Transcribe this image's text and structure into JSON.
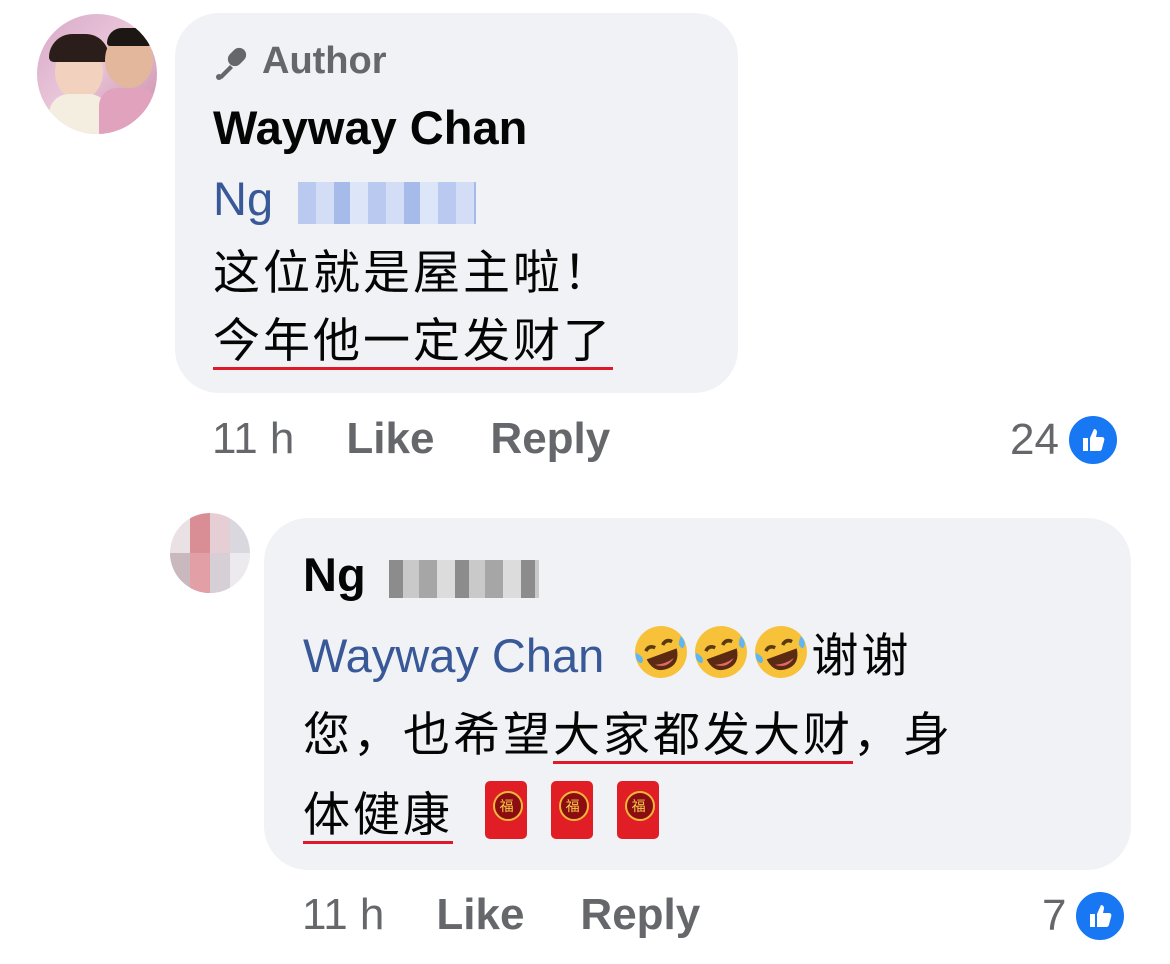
{
  "comment1": {
    "badge": "Author",
    "author": "Wayway Chan",
    "mention": "Ng",
    "line1": "这位就是屋主啦！",
    "line2": "今年他一定发财了",
    "time": "11 h",
    "like_label": "Like",
    "reply_label": "Reply",
    "like_count": "24"
  },
  "comment2": {
    "author": "Ng",
    "mention": "Wayway Chan",
    "emoji_name": "rolling-on-floor-laughing",
    "text_after_emoji": "谢谢",
    "line2_plain": "您，也希望",
    "line2_underlined": "大家都发大财",
    "line2_end": "，身",
    "line3_underlined": "体健康",
    "envelope_glyph": "福",
    "time": "11 h",
    "like_label": "Like",
    "reply_label": "Reply",
    "like_count": "7"
  },
  "colors": {
    "bubble": "#f0f2f5",
    "mention": "#385898",
    "meta": "#65676b",
    "like_blue": "#1877f2",
    "underline_red": "#e0192a"
  }
}
